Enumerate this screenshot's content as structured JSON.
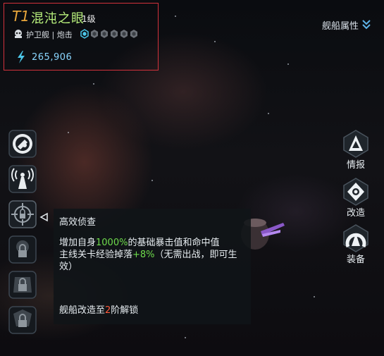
{
  "header": {
    "tier": "T1",
    "ship_name": "混沌之眼",
    "level": "1级",
    "ship_class": "护卫舰 | 炮击",
    "class_icon": "ship-class-icon",
    "star_count_total": 6,
    "star_count_filled": 1,
    "power_icon": "lightning-icon",
    "power": "265,906"
  },
  "attr_button": {
    "label": "舰船属性",
    "icon": "chevron-down-icon"
  },
  "skills": [
    {
      "name": "skill-missile",
      "icon": "missile-icon",
      "locked": false
    },
    {
      "name": "skill-radar",
      "icon": "radar-tower-icon",
      "locked": false
    },
    {
      "name": "skill-scope",
      "icon": "crosshair-icon",
      "locked": false,
      "selected": true
    },
    {
      "name": "skill-locked-1",
      "icon": "lock-icon",
      "locked": true
    },
    {
      "name": "skill-locked-2",
      "icon": "lock-icon",
      "locked": true
    },
    {
      "name": "skill-locked-3",
      "icon": "lock-icon",
      "locked": true
    }
  ],
  "tooltip": {
    "title": "高效侦查",
    "line1_prefix": "增加自身",
    "line1_value": "1000%",
    "line1_suffix": "的基础暴击值和命中值",
    "line2_prefix": "主线关卡经验掉落",
    "line2_value": "+8%",
    "line2_suffix": "（无需出战，即可生效）",
    "unlock_prefix": "舰船改造至",
    "unlock_value": "2",
    "unlock_suffix": "阶解锁"
  },
  "nav": [
    {
      "label": "情报",
      "icon": "intel-icon"
    },
    {
      "label": "改造",
      "icon": "modify-icon"
    },
    {
      "label": "装备",
      "icon": "equipment-icon"
    }
  ],
  "colors": {
    "tier": "#e9a63b",
    "name": "#b8f07c",
    "highlight_green": "#6fdc4c",
    "highlight_red": "#ff5a3c",
    "power": "#8ad6ff",
    "frame": "#d2323c"
  }
}
